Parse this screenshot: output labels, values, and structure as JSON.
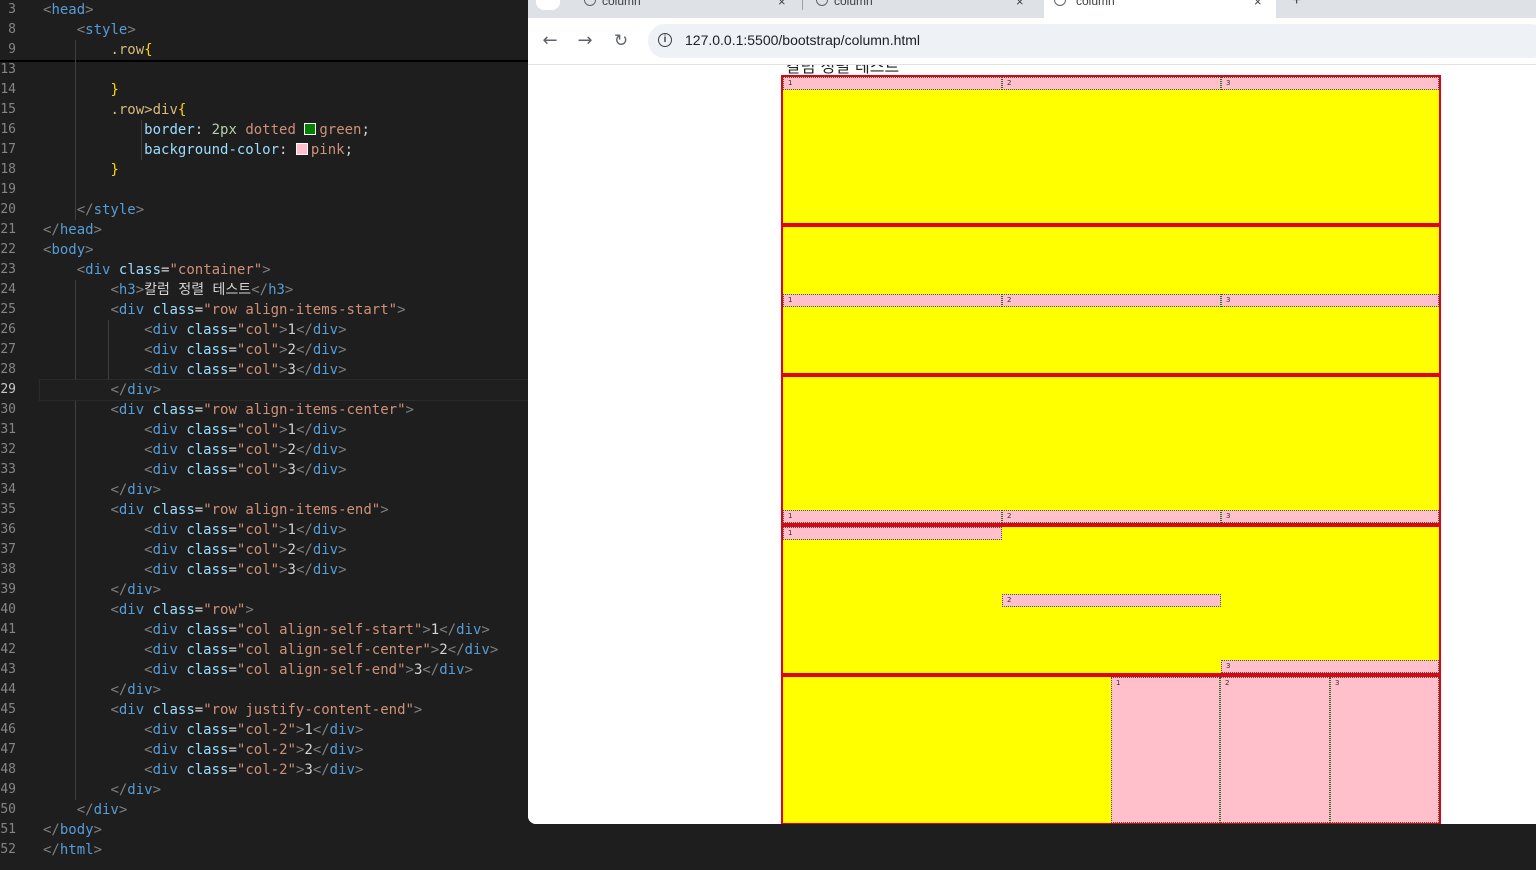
{
  "editor": {
    "line_numbers": [
      "3",
      "8",
      "9",
      "13",
      "14",
      "15",
      "16",
      "17",
      "18",
      "19",
      "20",
      "21",
      "22",
      "23",
      "24",
      "25",
      "26",
      "27",
      "28",
      "29",
      "30",
      "31",
      "32",
      "33",
      "34",
      "35",
      "36",
      "37",
      "38",
      "39",
      "40",
      "41",
      "42",
      "43",
      "44",
      "45",
      "46",
      "47",
      "48",
      "49",
      "50",
      "51",
      "52"
    ],
    "active_line": "29"
  },
  "browser": {
    "tabs": [
      {
        "label": "column",
        "close": "×"
      },
      {
        "label": "column",
        "close": "×"
      },
      {
        "label": "column",
        "close": "×"
      }
    ],
    "new_tab": "+",
    "back": "←",
    "forward": "→",
    "reload": "↻",
    "url": "127.0.0.1:5500/bootstrap/column.html"
  },
  "page": {
    "heading": "칼럼 정렬 테스트",
    "rows": [
      {
        "align": "start",
        "cols": [
          "1",
          "2",
          "3"
        ]
      },
      {
        "align": "center",
        "cols": [
          "1",
          "2",
          "3"
        ]
      },
      {
        "align": "end",
        "cols": [
          "1",
          "2",
          "3"
        ]
      },
      {
        "align": "self",
        "cols": [
          "1",
          "2",
          "3"
        ]
      },
      {
        "align": "justify-end",
        "cols": [
          "1",
          "2",
          "3"
        ]
      }
    ]
  },
  "colors": {
    "row_background": "#ffff00",
    "row_border": "#e5001a",
    "col_background": "#ffc0cb",
    "col_border": "#2b6a2b"
  }
}
